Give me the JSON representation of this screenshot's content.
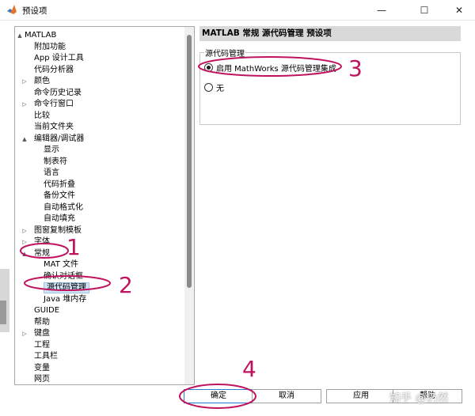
{
  "window": {
    "title": "预设项",
    "minimize": "—",
    "maximize": "☐",
    "close": "✕"
  },
  "tree": {
    "items": [
      {
        "label": "MATLAB",
        "level": 0,
        "expander": "▲"
      },
      {
        "label": "附加功能",
        "level": 1,
        "expander": ""
      },
      {
        "label": "App 设计工具",
        "level": 1,
        "expander": ""
      },
      {
        "label": "代码分析器",
        "level": 1,
        "expander": ""
      },
      {
        "label": "颜色",
        "level": 1,
        "expander": "▷"
      },
      {
        "label": "命令历史记录",
        "level": 1,
        "expander": ""
      },
      {
        "label": "命令行窗口",
        "level": 1,
        "expander": "▷"
      },
      {
        "label": "比较",
        "level": 1,
        "expander": ""
      },
      {
        "label": "当前文件夹",
        "level": 1,
        "expander": ""
      },
      {
        "label": "编辑器/调试器",
        "level": 1,
        "expander": "▲"
      },
      {
        "label": "显示",
        "level": 2,
        "expander": ""
      },
      {
        "label": "制表符",
        "level": 2,
        "expander": ""
      },
      {
        "label": "语言",
        "level": 2,
        "expander": ""
      },
      {
        "label": "代码折叠",
        "level": 2,
        "expander": ""
      },
      {
        "label": "备份文件",
        "level": 2,
        "expander": ""
      },
      {
        "label": "自动格式化",
        "level": 2,
        "expander": ""
      },
      {
        "label": "自动填充",
        "level": 2,
        "expander": ""
      },
      {
        "label": "图窗复制模板",
        "level": 1,
        "expander": "▷"
      },
      {
        "label": "字体",
        "level": 1,
        "expander": "▷"
      },
      {
        "label": "常规",
        "level": 1,
        "expander": "▲"
      },
      {
        "label": "MAT 文件",
        "level": 2,
        "expander": ""
      },
      {
        "label": "确认对话框",
        "level": 2,
        "expander": ""
      },
      {
        "label": "源代码管理",
        "level": 2,
        "expander": "",
        "selected": true
      },
      {
        "label": "Java 堆内存",
        "level": 2,
        "expander": ""
      },
      {
        "label": "GUIDE",
        "level": 1,
        "expander": ""
      },
      {
        "label": "帮助",
        "level": 1,
        "expander": ""
      },
      {
        "label": "键盘",
        "level": 1,
        "expander": "▷"
      },
      {
        "label": "工程",
        "level": 1,
        "expander": ""
      },
      {
        "label": "工具栏",
        "level": 1,
        "expander": ""
      },
      {
        "label": "变量",
        "level": 1,
        "expander": ""
      },
      {
        "label": "网页",
        "level": 1,
        "expander": ""
      }
    ]
  },
  "panel": {
    "header": "MATLAB 常规 源代码管理 预设项",
    "group_title": "源代码管理",
    "options": [
      {
        "label": "启用 MathWorks 源代码管理集成",
        "checked": true
      },
      {
        "label": "无",
        "checked": false
      }
    ]
  },
  "buttons": {
    "ok": "确定",
    "cancel": "取消",
    "apply": "应用",
    "help": "帮助"
  },
  "annotations": {
    "marks": [
      "1",
      "2",
      "3",
      "4"
    ],
    "color": "#c0135f"
  },
  "watermark": "知乎 @仍然",
  "colors": {
    "selection": "#cfe4f7",
    "header_bg": "#d9d9d9",
    "annotation": "#c0135f"
  }
}
